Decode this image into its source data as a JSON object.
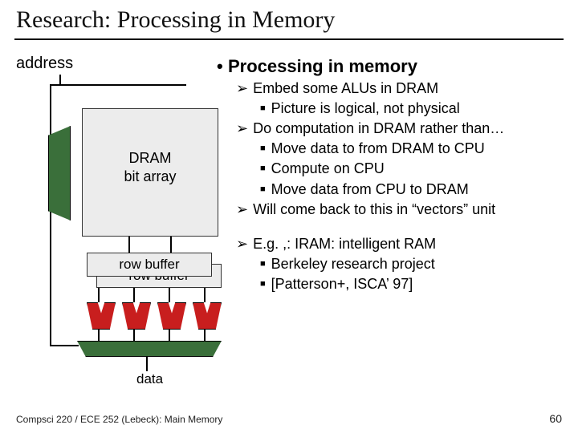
{
  "title": "Research: Processing in Memory",
  "labels": {
    "address": "address",
    "dram_box_l1": "DRAM",
    "dram_box_l2": "bit array",
    "row_buffer": "row buffer",
    "data": "data"
  },
  "bullets": {
    "h": "Processing in memory",
    "a1": "Embed some ALUs in DRAM",
    "a1_1": "Picture is logical, not physical",
    "a2": "Do computation in DRAM rather than…",
    "a2_1": "Move data to from DRAM to CPU",
    "a2_2": "Compute on CPU",
    "a2_3": "Move data from CPU to DRAM",
    "a3": "Will come back to this in “vectors” unit",
    "b1": "E.g. ,: IRAM: intelligent RAM",
    "b1_1": "Berkeley research project",
    "b1_2": "[Patterson+, ISCA’ 97]"
  },
  "footer": {
    "course": "Compsci 220 / ECE 252 (Lebeck): Main Memory",
    "page": "60"
  }
}
